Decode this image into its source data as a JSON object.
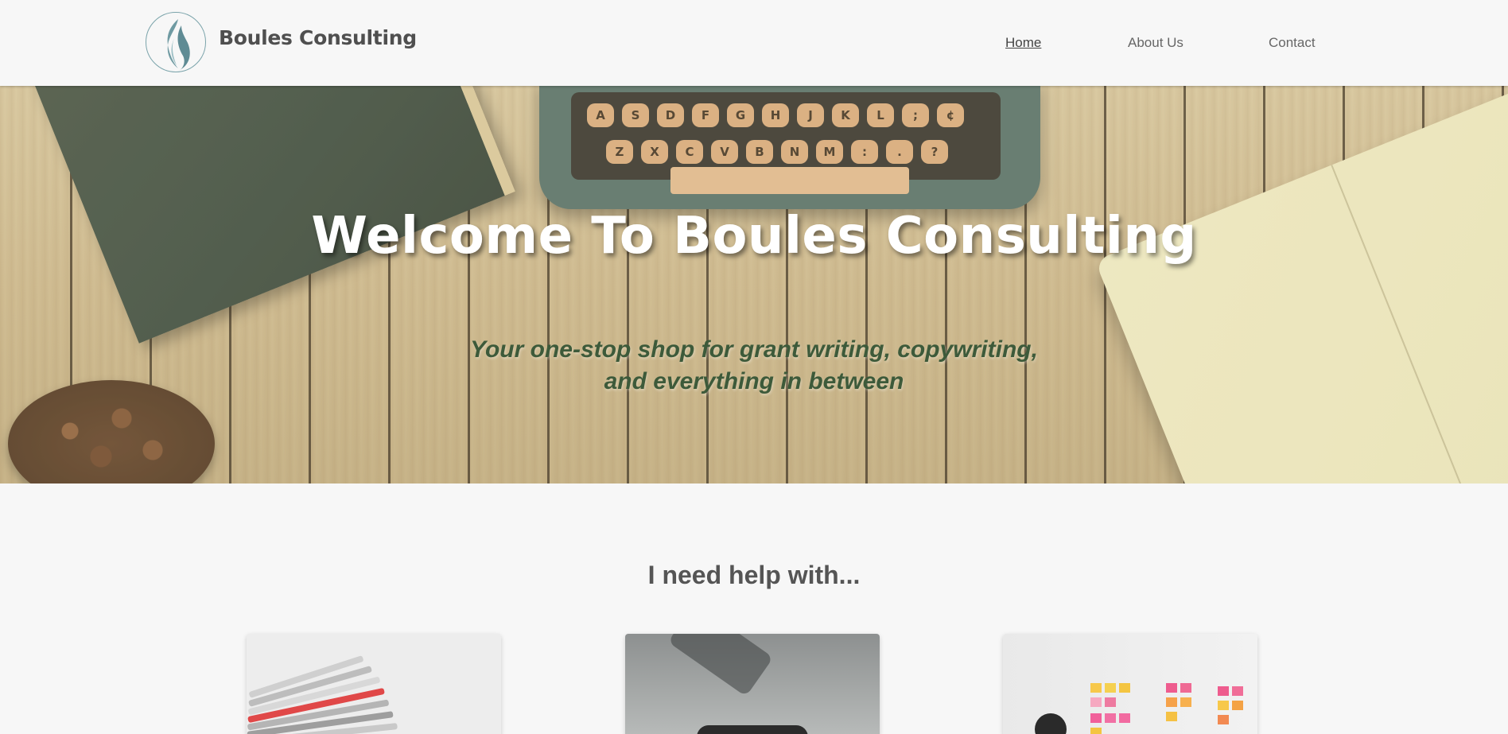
{
  "header": {
    "brand": "Boules Consulting",
    "logo_icon": "flame-logo-icon",
    "nav": [
      {
        "label": "Home",
        "active": true
      },
      {
        "label": "About Us",
        "active": false
      },
      {
        "label": "Contact",
        "active": false
      }
    ]
  },
  "hero": {
    "title": "Welcome To Boules Consulting",
    "subtitle_line1": "Your one-stop shop for grant writing, copywriting,",
    "subtitle_line2": "and everything in between"
  },
  "services": {
    "title": "I need help with..."
  },
  "colors": {
    "background": "#f7f7f7",
    "brand_text": "#4f4f4f",
    "logo_accent": "#7aa3aa",
    "subtitle_green": "#3d5a3a"
  }
}
